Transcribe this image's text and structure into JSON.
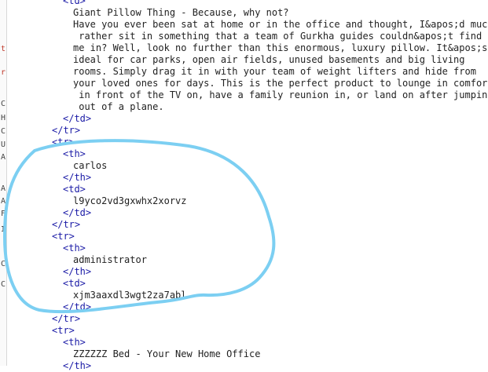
{
  "gutter": [
    "t",
    "r",
    "C",
    "H",
    "C",
    "U",
    "A",
    "A",
    "A",
    "F",
    "I",
    "C",
    "C"
  ],
  "lines": [
    {
      "indent": 80,
      "kind": "tag",
      "text": "<td>"
    },
    {
      "indent": 93,
      "kind": "text",
      "text": "Giant Pillow Thing - Because, why not?"
    },
    {
      "indent": 93,
      "kind": "text",
      "text": "Have you ever been sat at home or in the office and thought, I&apos;d much"
    },
    {
      "indent": 93,
      "kind": "text",
      "text": " rather sit in something that a team of Gurkha guides couldn&apos;t find"
    },
    {
      "indent": 93,
      "kind": "text",
      "text": "me in? Well, look no further than this enormous, luxury pillow. It&apos;s"
    },
    {
      "indent": 93,
      "kind": "text",
      "text": "ideal for car parks, open air fields, unused basements and big living"
    },
    {
      "indent": 93,
      "kind": "text",
      "text": "rooms. Simply drag it in with your team of weight lifters and hide from"
    },
    {
      "indent": 93,
      "kind": "text",
      "text": "your loved ones for days. This is the perfect product to lounge in comfort"
    },
    {
      "indent": 93,
      "kind": "text",
      "text": " in front of the TV on, have a family reunion in, or land on after jumping"
    },
    {
      "indent": 93,
      "kind": "text",
      "text": " out of a plane."
    },
    {
      "indent": 80,
      "kind": "tag",
      "text": "</td>"
    },
    {
      "indent": 66,
      "kind": "tag",
      "text": "</tr>"
    },
    {
      "indent": 66,
      "kind": "tag",
      "text": "<tr>"
    },
    {
      "indent": 80,
      "kind": "tag",
      "text": "<th>"
    },
    {
      "indent": 93,
      "kind": "text",
      "text": "carlos"
    },
    {
      "indent": 80,
      "kind": "tag",
      "text": "</th>"
    },
    {
      "indent": 80,
      "kind": "tag",
      "text": "<td>"
    },
    {
      "indent": 93,
      "kind": "text",
      "text": "l9yco2vd3gxwhx2xorvz"
    },
    {
      "indent": 80,
      "kind": "tag",
      "text": "</td>"
    },
    {
      "indent": 66,
      "kind": "tag",
      "text": "</tr>"
    },
    {
      "indent": 66,
      "kind": "tag",
      "text": "<tr>"
    },
    {
      "indent": 80,
      "kind": "tag",
      "text": "<th>"
    },
    {
      "indent": 93,
      "kind": "text",
      "text": "administrator"
    },
    {
      "indent": 80,
      "kind": "tag",
      "text": "</th>"
    },
    {
      "indent": 80,
      "kind": "tag",
      "text": "<td>"
    },
    {
      "indent": 93,
      "kind": "text",
      "text": "xjm3aaxdl3wgt2za7abl"
    },
    {
      "indent": 80,
      "kind": "tag",
      "text": "</td>"
    },
    {
      "indent": 66,
      "kind": "tag",
      "text": "</tr>"
    },
    {
      "indent": 66,
      "kind": "tag",
      "text": "<tr>"
    },
    {
      "indent": 80,
      "kind": "tag",
      "text": "<th>"
    },
    {
      "indent": 93,
      "kind": "text",
      "text": "ZZZZZZ Bed - Your New Home Office"
    },
    {
      "indent": 80,
      "kind": "tag",
      "text": "</th>"
    }
  ],
  "highlight": {
    "color": "#7ccff2"
  }
}
